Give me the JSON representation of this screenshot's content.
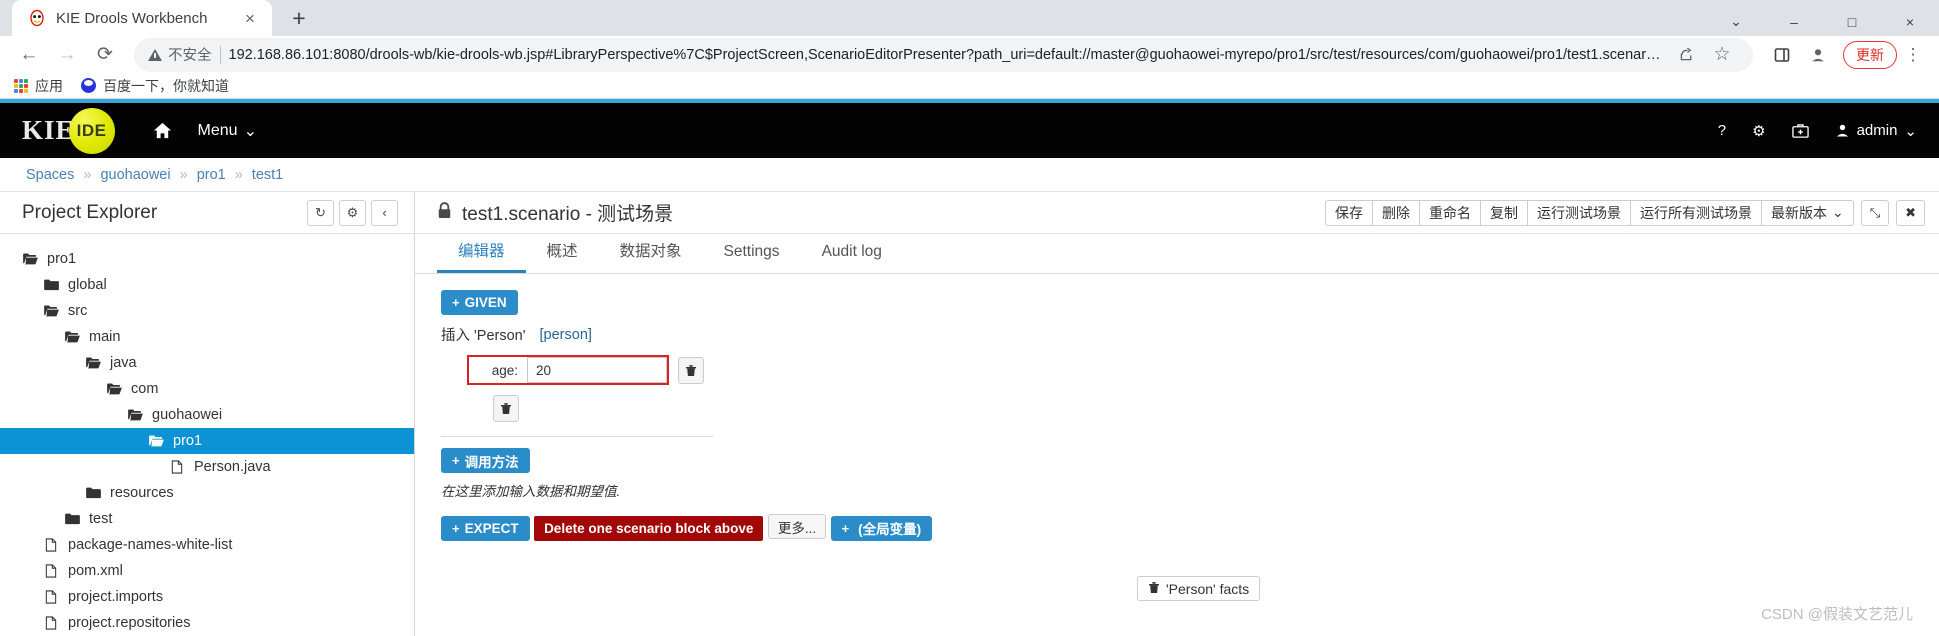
{
  "browser": {
    "tab": {
      "title": "KIE Drools Workbench",
      "favicon": "drools-favicon",
      "close": "×"
    },
    "new_tab": "+",
    "window_controls": {
      "minimize": "–",
      "maximize": "□",
      "close": "×",
      "dropdown": "⌄"
    },
    "nav": {
      "back": "←",
      "forward": "→",
      "reload": "⟳"
    },
    "omnibox": {
      "security_label": "不安全",
      "url": "192.168.86.101:8080/drools-wb/kie-drools-wb.jsp#LibraryPerspective%7C$ProjectScreen,ScenarioEditorPresenter?path_uri=default://master@guohaowei-myrepo/pro1/src/test/resources/com/guohaowei/pro1/test1.scenari…",
      "share_icon": "share-icon",
      "star_icon": "☆"
    },
    "toolbar_right": {
      "sidepanel_icon": "▢",
      "profile_icon": "●",
      "update_label": "更新",
      "menu_icon": "⋮"
    },
    "bookmarks": [
      {
        "label": "应用",
        "icon": "apps-grid-icon"
      },
      {
        "label": "百度一下，你就知道",
        "icon": "baidu-icon"
      }
    ]
  },
  "navbar": {
    "logo_text": "KIE",
    "logo_badge": "IDE",
    "home_icon": "home-icon",
    "menu_label": "Menu",
    "menu_caret": "⌄",
    "right": {
      "help": "?",
      "gear": "⚙",
      "kit": "kit-icon",
      "user_label": "admin",
      "user_caret": "⌄"
    }
  },
  "breadcrumb": {
    "items": [
      "Spaces",
      "guohaowei",
      "pro1",
      "test1"
    ],
    "separator": "»"
  },
  "sidebar": {
    "title": "Project Explorer",
    "buttons": [
      {
        "name": "refresh",
        "glyph": "↻"
      },
      {
        "name": "settings",
        "glyph": "⚙"
      },
      {
        "name": "collapse",
        "glyph": "‹"
      }
    ],
    "tree": [
      {
        "label": "pro1",
        "indent": 0,
        "type": "folder-open",
        "selected": false
      },
      {
        "label": "global",
        "indent": 1,
        "type": "folder-closed",
        "selected": false
      },
      {
        "label": "src",
        "indent": 1,
        "type": "folder-open",
        "selected": false
      },
      {
        "label": "main",
        "indent": 2,
        "type": "folder-open",
        "selected": false
      },
      {
        "label": "java",
        "indent": 3,
        "type": "folder-open",
        "selected": false
      },
      {
        "label": "com",
        "indent": 4,
        "type": "folder-open",
        "selected": false
      },
      {
        "label": "guohaowei",
        "indent": 5,
        "type": "folder-open",
        "selected": false
      },
      {
        "label": "pro1",
        "indent": 6,
        "type": "folder-open",
        "selected": true
      },
      {
        "label": "Person.java",
        "indent": 7,
        "type": "file",
        "selected": false
      },
      {
        "label": "resources",
        "indent": 3,
        "type": "folder-closed",
        "selected": false
      },
      {
        "label": "test",
        "indent": 2,
        "type": "folder-closed",
        "selected": false
      },
      {
        "label": "package-names-white-list",
        "indent": 1,
        "type": "file",
        "selected": false
      },
      {
        "label": "pom.xml",
        "indent": 1,
        "type": "file",
        "selected": false
      },
      {
        "label": "project.imports",
        "indent": 1,
        "type": "file",
        "selected": false
      },
      {
        "label": "project.repositories",
        "indent": 1,
        "type": "file",
        "selected": false
      }
    ]
  },
  "editor": {
    "lock_icon": "lock-icon",
    "title": "test1.scenario - 测试场景",
    "toolbar": {
      "group": [
        "保存",
        "删除",
        "重命名",
        "复制",
        "运行测试场景",
        "运行所有测试场景"
      ],
      "version_label": "最新版本",
      "version_caret": "⌄",
      "expand_glyph": "⤡",
      "close_glyph": "✖"
    },
    "tabs": [
      {
        "label": "编辑器",
        "active": true
      },
      {
        "label": "概述",
        "active": false
      },
      {
        "label": "数据对象",
        "active": false
      },
      {
        "label": "Settings",
        "active": false
      },
      {
        "label": "Audit log",
        "active": false
      }
    ],
    "content": {
      "given_button": {
        "plus": "+",
        "label": "GIVEN"
      },
      "insert_text": "插入 'Person'",
      "insert_binding": "[person]",
      "facts_button": {
        "trash": "🗑",
        "label": "'Person' facts"
      },
      "field": {
        "label": "age:",
        "value": "20"
      },
      "field_trash": "🗑",
      "block_trash": "🗑",
      "call_method_button": {
        "plus": "+",
        "label": "调用方法"
      },
      "hint": "在这里添加输入数据和期望值.",
      "expect_button": {
        "plus": "+",
        "label": "EXPECT"
      },
      "delete_block_button": "Delete one scenario block above",
      "more_button": "更多...",
      "global_button": {
        "plus": "+",
        "label": "(全局变量)"
      }
    }
  },
  "watermark": "CSDN @假装文艺范儿",
  "colors": {
    "accent_blue": "#39a5dc",
    "navbar_black": "#030303",
    "primary_button": "#2a8cc8",
    "danger": "#a30808",
    "field_highlight": "#e02020",
    "tree_selected": "#0b93d5"
  }
}
